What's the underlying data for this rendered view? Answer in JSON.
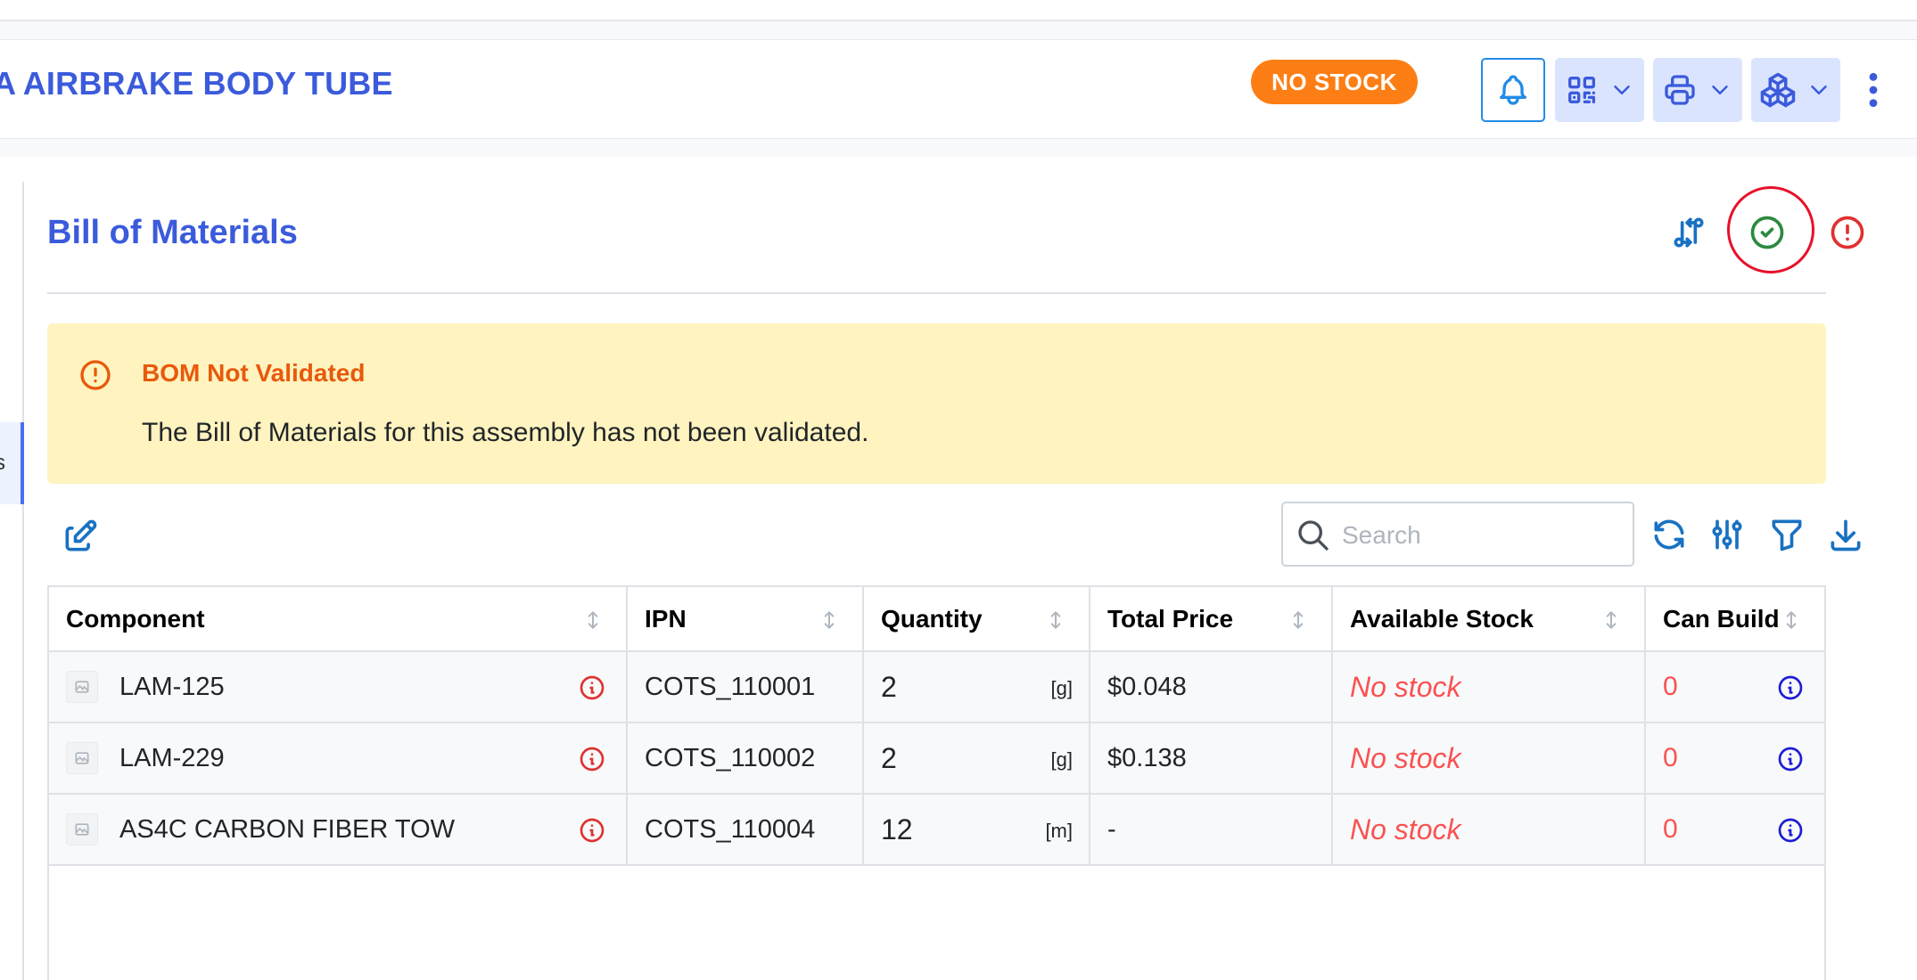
{
  "header": {
    "part_title": "A AIRBRAKE BODY TUBE",
    "stock_badge": "NO STOCK",
    "accent_color": "#3b5bdb",
    "badge_color": "#fd7e14"
  },
  "sidebar": {
    "active_tab_label": "s"
  },
  "bom": {
    "title": "Bill of Materials",
    "alert": {
      "title": "BOM Not Validated",
      "message": "The Bill of Materials for this assembly has not been validated."
    },
    "search": {
      "placeholder": "Search",
      "value": ""
    },
    "columns": [
      "Component",
      "IPN",
      "Quantity",
      "Total Price",
      "Available Stock",
      "Can Build"
    ],
    "rows": [
      {
        "component": "LAM-125",
        "ipn": "COTS_110001",
        "quantity": "2",
        "unit": "[g]",
        "total_price": "$0.048",
        "available_stock": "No stock",
        "can_build": "0"
      },
      {
        "component": "LAM-229",
        "ipn": "COTS_110002",
        "quantity": "2",
        "unit": "[g]",
        "total_price": "$0.138",
        "available_stock": "No stock",
        "can_build": "0"
      },
      {
        "component": "AS4C CARBON FIBER TOW",
        "ipn": "COTS_110004",
        "quantity": "12",
        "unit": "[m]",
        "total_price": "-",
        "available_stock": "No stock",
        "can_build": "0"
      }
    ]
  },
  "icons": {
    "header_actions": [
      "bell-icon",
      "qr-code-icon",
      "printer-icon",
      "packages-icon",
      "dots-vertical-icon"
    ],
    "bom_actions": [
      "switch-horizontal-icon",
      "circle-check-icon",
      "alert-circle-icon"
    ],
    "table_actions": [
      "edit-icon",
      "refresh-icon",
      "adjustments-icon",
      "filter-icon",
      "download-icon"
    ]
  }
}
